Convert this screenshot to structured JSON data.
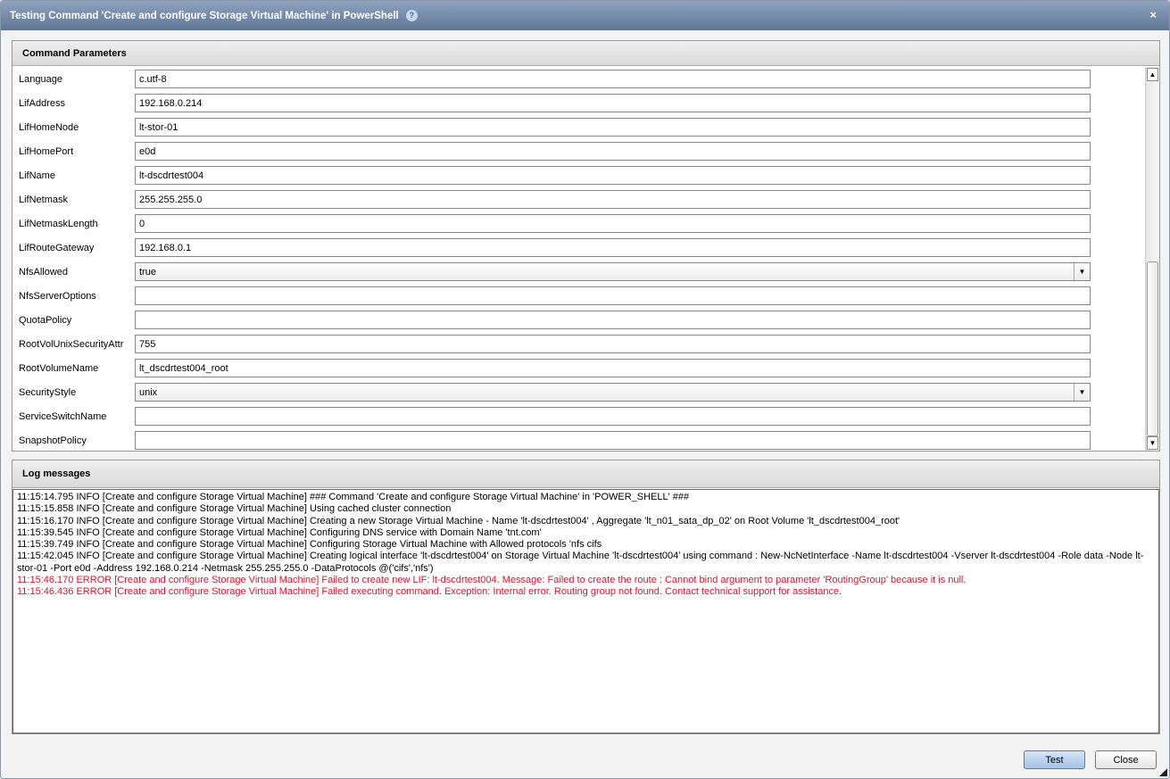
{
  "title": "Testing Command 'Create and configure Storage Virtual Machine' in PowerShell",
  "params": {
    "header": "Command Parameters",
    "rows": [
      {
        "label": "Language",
        "value": "c.utf-8"
      },
      {
        "label": "LifAddress",
        "value": "192.168.0.214"
      },
      {
        "label": "LifHomeNode",
        "value": "lt-stor-01"
      },
      {
        "label": "LifHomePort",
        "value": "e0d"
      },
      {
        "label": "LifName",
        "value": "lt-dscdrtest004"
      },
      {
        "label": "LifNetmask",
        "value": "255.255.255.0"
      },
      {
        "label": "LifNetmaskLength",
        "value": "0"
      },
      {
        "label": "LifRouteGateway",
        "value": "192.168.0.1"
      },
      {
        "label": "NfsAllowed",
        "value": "true",
        "select": true
      },
      {
        "label": "NfsServerOptions",
        "value": ""
      },
      {
        "label": "QuotaPolicy",
        "value": ""
      },
      {
        "label": "RootVolUnixSecurityAttr",
        "value": "755"
      },
      {
        "label": "RootVolumeName",
        "value": "lt_dscdrtest004_root"
      },
      {
        "label": "SecurityStyle",
        "value": "unix",
        "select": true
      },
      {
        "label": "ServiceSwitchName",
        "value": ""
      },
      {
        "label": "SnapshotPolicy",
        "value": ""
      }
    ]
  },
  "log": {
    "header": "Log messages",
    "lines": [
      {
        "text": "11:15:14.795 INFO  [Create and configure Storage Virtual Machine] ### Command 'Create and configure Storage Virtual Machine' in 'POWER_SHELL' ###",
        "error": false
      },
      {
        "text": "11:15:15.858 INFO  [Create and configure Storage Virtual Machine] Using cached cluster connection",
        "error": false
      },
      {
        "text": "11:15:16.170 INFO  [Create and configure Storage Virtual Machine] Creating a new Storage Virtual Machine - Name 'lt-dscdrtest004' , Aggregate 'lt_n01_sata_dp_02' on Root Volume 'lt_dscdrtest004_root'",
        "error": false
      },
      {
        "text": "11:15:39.545 INFO  [Create and configure Storage Virtual Machine] Configuring DNS service with Domain Name 'tnt.com'",
        "error": false
      },
      {
        "text": "11:15:39.749 INFO  [Create and configure Storage Virtual Machine] Configuring Storage Virtual Machine with Allowed protocols 'nfs cifs",
        "error": false
      },
      {
        "text": "11:15:42.045 INFO  [Create and configure Storage Virtual Machine] Creating logical interface  'lt-dscdrtest004' on Storage Virtual Machine 'lt-dscdrtest004' using command : New-NcNetInterface -Name lt-dscdrtest004 -Vserver lt-dscdrtest004 -Role data  -Node lt-stor-01 -Port e0d -Address 192.168.0.214 -Netmask 255.255.255.0 -DataProtocols @('cifs','nfs')",
        "error": false
      },
      {
        "text": "11:15:46.170 ERROR  [Create and configure Storage Virtual Machine] Failed to create new LIF: lt-dscdrtest004. Message: Failed to create the route : Cannot bind argument to parameter 'RoutingGroup' because it is null.",
        "error": true
      },
      {
        "text": "11:15:46.436 ERROR  [Create and configure Storage Virtual Machine] Failed executing command. Exception: Internal error. Routing group  not found. Contact technical support for assistance.",
        "error": true
      }
    ]
  },
  "buttons": {
    "test": "Test",
    "close": "Close"
  },
  "help_icon": "?",
  "close_icon": "×"
}
